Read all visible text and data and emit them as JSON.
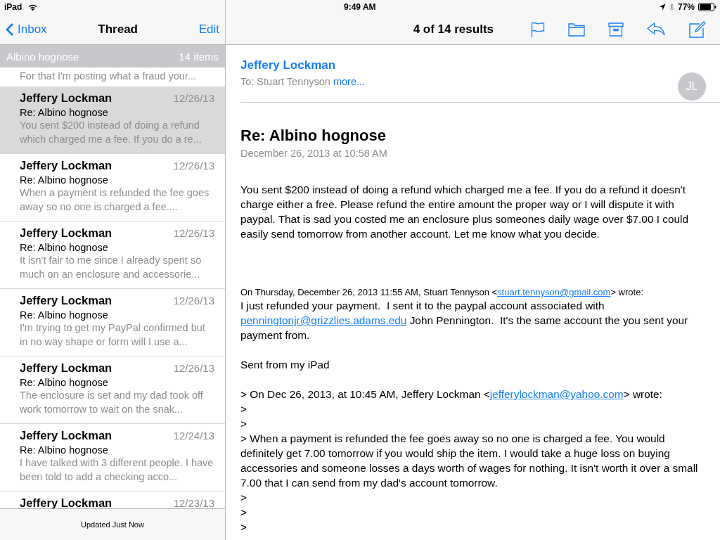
{
  "status_bar": {
    "device": "iPad",
    "time": "9:49 AM",
    "battery": "77%"
  },
  "list_nav": {
    "back": "Inbox",
    "title": "Thread",
    "action": "Edit"
  },
  "thread_header": {
    "subject": "Albino hognose",
    "count": "14 items"
  },
  "messages": [
    {
      "preview": "For that I'm posting what a fraud your...",
      "selected": false
    },
    {
      "sender": "Jeffery Lockman",
      "date": "12/26/13",
      "subject": "Re: Albino hognose",
      "preview": "You sent $200 instead of doing a refund which charged me a fee. If you do a re...",
      "selected": true
    },
    {
      "sender": "Jeffery Lockman",
      "date": "12/26/13",
      "subject": "Re: Albino hognose",
      "preview": "When a payment is refunded the fee goes away so no one is charged a fee....",
      "selected": false
    },
    {
      "sender": "Jeffery Lockman",
      "date": "12/26/13",
      "subject": "Re: Albino hognose",
      "preview": "It isn't fair to me since I already spent so much on an enclosure and accessorie...",
      "selected": false
    },
    {
      "sender": "Jeffery Lockman",
      "date": "12/26/13",
      "subject": "Re: Albino hognose",
      "preview": "I'm trying to get my PayPal confirmed but in no way shape or form will I use a...",
      "selected": false
    },
    {
      "sender": "Jeffery Lockman",
      "date": "12/26/13",
      "subject": "Re: Albino hognose",
      "preview": "The enclosure is set and my dad took off work tomorrow to wait on the snak...",
      "selected": false
    },
    {
      "sender": "Jeffery Lockman",
      "date": "12/24/13",
      "subject": "Re: Albino hognose",
      "preview": "I have talked with 3 different people. I have been told to add a checking acco...",
      "selected": false
    },
    {
      "sender": "Jeffery Lockman",
      "date": "12/23/13",
      "selected": false
    }
  ],
  "list_footer": "Updated Just Now",
  "toolbar": {
    "result_count": "4 of 14 results"
  },
  "message": {
    "from": "Jeffery Lockman",
    "to_label": "To:",
    "to": "Stuart Tennyson",
    "more": "more...",
    "avatar": "JL",
    "subject": "Re: Albino hognose",
    "date": "December 26, 2013 at 10:58 AM",
    "body": [
      {
        "kind": "body",
        "segments": [
          {
            "kind": "text",
            "text": "You sent $200 instead of doing a refund which charged me a fee. If you do a refund it doesn't charge either a free. Please refund the entire amount the proper way or I will dispute it with paypal. That is sad you costed me an enclosure plus someones daily wage over $7.00 I could easily send tomorrow from another account. Let me know what you decide."
          }
        ]
      },
      {
        "kind": "attribution",
        "segments": [
          {
            "kind": "text",
            "text": "On Thursday, December 26, 2013 11:55 AM, Stuart Tennyson <"
          },
          {
            "kind": "link",
            "text": "stuart.tennyson@gmail.com"
          },
          {
            "kind": "text",
            "text": "> wrote:"
          }
        ]
      },
      {
        "kind": "body",
        "segments": [
          {
            "kind": "text",
            "text": "I just refunded your payment.  I sent it to the paypal account associated with "
          },
          {
            "kind": "link",
            "text": "penningtonjr@grizzlies.adams.edu"
          },
          {
            "kind": "text",
            "text": " John Pennington.  It's the same account the you sent your payment from."
          }
        ]
      },
      {
        "kind": "spaced",
        "segments": [
          {
            "kind": "text",
            "text": "Sent from my iPad"
          }
        ]
      },
      {
        "kind": "spaced",
        "segments": [
          {
            "kind": "text",
            "text": "> On Dec 26, 2013, at 10:45 AM, Jeffery Lockman <"
          },
          {
            "kind": "link",
            "text": "jefferylockman@yahoo.com"
          },
          {
            "kind": "text",
            "text": "> wrote:"
          }
        ]
      },
      {
        "kind": "body",
        "segments": [
          {
            "kind": "text",
            "text": ">"
          }
        ]
      },
      {
        "kind": "body",
        "segments": [
          {
            "kind": "text",
            "text": ">"
          }
        ]
      },
      {
        "kind": "body",
        "segments": [
          {
            "kind": "text",
            "text": "> When a payment is refunded the fee goes away so no one is charged a fee. You would definitely get 7.00 tomorrow if you would ship the item. I would take a huge loss on buying accessories and someone losses a days worth of wages for nothing. It isn't worth it over a small 7.00 that I can send from my dad's account tomorrow."
          }
        ]
      },
      {
        "kind": "body",
        "segments": [
          {
            "kind": "text",
            "text": ">"
          }
        ]
      },
      {
        "kind": "body",
        "segments": [
          {
            "kind": "text",
            "text": ">"
          }
        ]
      },
      {
        "kind": "body",
        "segments": [
          {
            "kind": "text",
            "text": ">"
          }
        ]
      }
    ]
  }
}
